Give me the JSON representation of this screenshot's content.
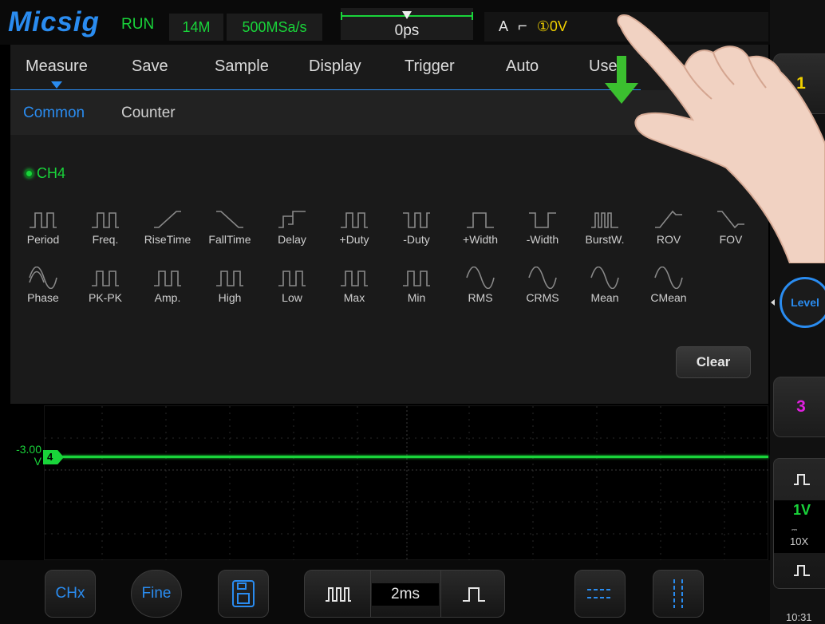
{
  "topbar": {
    "logo": "Micsig",
    "run_status": "RUN",
    "memory_depth": "14M",
    "sample_rate": "500MSa/s",
    "time_position": "0ps",
    "trigger_mode": "A",
    "trigger_slope": "╭",
    "trigger_source_level": "①0V"
  },
  "menu": {
    "items": [
      {
        "label": "Measure",
        "selected": true
      },
      {
        "label": "Save"
      },
      {
        "label": "Sample"
      },
      {
        "label": "Display"
      },
      {
        "label": "Trigger"
      },
      {
        "label": "Auto"
      },
      {
        "label": "User"
      }
    ]
  },
  "submenu": {
    "items": [
      {
        "label": "Common",
        "active": true
      },
      {
        "label": "Counter"
      }
    ]
  },
  "channel_select": {
    "label": "CH4"
  },
  "measurements": [
    {
      "label": "Period",
      "icon": "period-icon"
    },
    {
      "label": "Freq.",
      "icon": "frequency-icon"
    },
    {
      "label": "RiseTime",
      "icon": "rise-time-icon"
    },
    {
      "label": "FallTime",
      "icon": "fall-time-icon"
    },
    {
      "label": "Delay",
      "icon": "delay-icon"
    },
    {
      "label": "+Duty",
      "icon": "positive-duty-icon"
    },
    {
      "label": "-Duty",
      "icon": "negative-duty-icon"
    },
    {
      "label": "+Width",
      "icon": "positive-width-icon"
    },
    {
      "label": "-Width",
      "icon": "negative-width-icon"
    },
    {
      "label": "BurstW.",
      "icon": "burst-width-icon"
    },
    {
      "label": "ROV",
      "icon": "rise-overshoot-icon"
    },
    {
      "label": "FOV",
      "icon": "fall-overshoot-icon"
    },
    {
      "label": "Phase",
      "icon": "phase-icon"
    },
    {
      "label": "PK-PK",
      "icon": "peak-to-peak-icon"
    },
    {
      "label": "Amp.",
      "icon": "amplitude-icon"
    },
    {
      "label": "High",
      "icon": "high-icon"
    },
    {
      "label": "Low",
      "icon": "low-icon"
    },
    {
      "label": "Max",
      "icon": "max-icon"
    },
    {
      "label": "Min",
      "icon": "min-icon"
    },
    {
      "label": "RMS",
      "icon": "rms-icon"
    },
    {
      "label": "CRMS",
      "icon": "cycle-rms-icon"
    },
    {
      "label": "Mean",
      "icon": "mean-icon"
    },
    {
      "label": "CMean",
      "icon": "cycle-mean-icon"
    }
  ],
  "panel": {
    "clear_label": "Clear"
  },
  "waveform": {
    "channel": "4",
    "offset": "-3.00",
    "offset_unit": "V",
    "trace_color": "#19d43a"
  },
  "bottom": {
    "chx_label": "CHx",
    "fine_label": "Fine",
    "timebase": "2ms"
  },
  "rightpanel": {
    "ch1_label": "1",
    "level_label": "Level",
    "ch3_label": "3",
    "volts_div": "1V",
    "probe": "10X",
    "clock": "10:31"
  },
  "colors": {
    "accent": "#2a8cf0",
    "ch4": "#19d43a",
    "ch1": "#f0d000",
    "ch3": "#e020e0",
    "panel_bg": "#1a1a1a"
  }
}
